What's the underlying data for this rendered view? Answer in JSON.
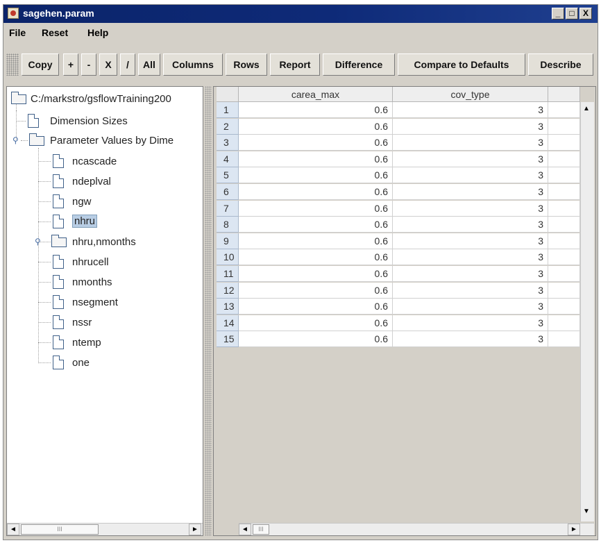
{
  "window": {
    "title": "sagehen.param",
    "controls": [
      "_",
      "□",
      "X"
    ]
  },
  "menu": [
    "File",
    "Reset",
    "Help"
  ],
  "toolbar": [
    "Copy",
    "+",
    "-",
    "X",
    "/",
    "All",
    "Columns",
    "Rows",
    "Report",
    "Difference",
    "Compare to Defaults",
    "Describe"
  ],
  "tree": {
    "root": "C:/markstro/gsflowTraining200",
    "dimension_sizes": "Dimension Sizes",
    "param_values": "Parameter Values by Dime",
    "children": [
      "ncascade",
      "ndeplval",
      "ngw",
      "nhru",
      "nhru,nmonths",
      "nhrucell",
      "nmonths",
      "nsegment",
      "nssr",
      "ntemp",
      "one"
    ],
    "selected": "nhru"
  },
  "table": {
    "columns": [
      "carea_max",
      "cov_type"
    ],
    "rows": [
      {
        "n": "1",
        "carea_max": "0.6",
        "cov_type": "3"
      },
      {
        "n": "2",
        "carea_max": "0.6",
        "cov_type": "3"
      },
      {
        "n": "3",
        "carea_max": "0.6",
        "cov_type": "3"
      },
      {
        "n": "4",
        "carea_max": "0.6",
        "cov_type": "3"
      },
      {
        "n": "5",
        "carea_max": "0.6",
        "cov_type": "3"
      },
      {
        "n": "6",
        "carea_max": "0.6",
        "cov_type": "3"
      },
      {
        "n": "7",
        "carea_max": "0.6",
        "cov_type": "3"
      },
      {
        "n": "8",
        "carea_max": "0.6",
        "cov_type": "3"
      },
      {
        "n": "9",
        "carea_max": "0.6",
        "cov_type": "3"
      },
      {
        "n": "10",
        "carea_max": "0.6",
        "cov_type": "3"
      },
      {
        "n": "11",
        "carea_max": "0.6",
        "cov_type": "3"
      },
      {
        "n": "12",
        "carea_max": "0.6",
        "cov_type": "3"
      },
      {
        "n": "13",
        "carea_max": "0.6",
        "cov_type": "3"
      },
      {
        "n": "14",
        "carea_max": "0.6",
        "cov_type": "3"
      },
      {
        "n": "15",
        "carea_max": "0.6",
        "cov_type": "3"
      }
    ]
  },
  "scroll": {
    "left_arrow": "◄",
    "right_arrow": "►",
    "up_arrow": "▲",
    "down_arrow": "▼",
    "thumb": "III"
  }
}
